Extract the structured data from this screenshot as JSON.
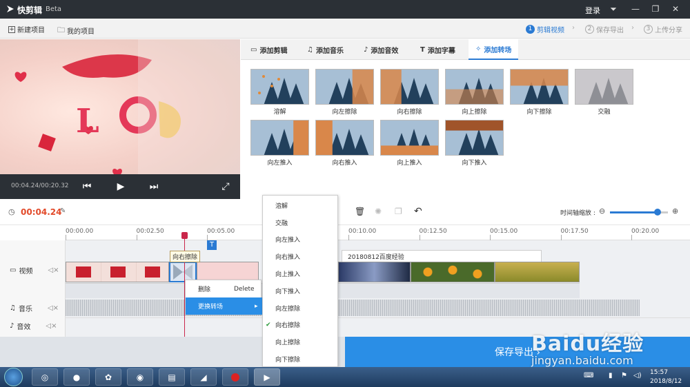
{
  "titlebar": {
    "app_name": "快剪辑",
    "beta": "Beta",
    "login": "登录"
  },
  "toolbar": {
    "new_project": "新建项目",
    "my_projects": "我的项目"
  },
  "steps": [
    {
      "num": "1",
      "label": "剪辑视频"
    },
    {
      "num": "2",
      "label": "保存导出"
    },
    {
      "num": "3",
      "label": "上传分享"
    }
  ],
  "preview": {
    "time": "00:04.24/00:20.32"
  },
  "tabs": [
    {
      "label": "添加剪辑"
    },
    {
      "label": "添加音乐"
    },
    {
      "label": "添加音效"
    },
    {
      "label": "添加字幕"
    },
    {
      "label": "添加转场"
    }
  ],
  "transitions": [
    {
      "label": "溶解"
    },
    {
      "label": "向左擦除"
    },
    {
      "label": "向右擦除"
    },
    {
      "label": "向上擦除"
    },
    {
      "label": "向下擦除"
    },
    {
      "label": "交融"
    },
    {
      "label": "向左推入"
    },
    {
      "label": "向右推入"
    },
    {
      "label": "向上推入"
    },
    {
      "label": "向下推入"
    }
  ],
  "timeline": {
    "current_time": "00:04.24",
    "zoom_label": "时间轴缩放 :",
    "zoom_level": 0.82,
    "ruler": [
      "00:00.00",
      "00:02.50",
      "00:05.00",
      "00:07.50",
      "00:10.00",
      "00:12.50",
      "00:15.00",
      "00:17.50",
      "00:20.00"
    ],
    "text_marker": "T",
    "subtitle_clip": "20180812百度经验"
  },
  "tracks": {
    "video": "视频",
    "music": "音乐",
    "sfx": "音效"
  },
  "tooltip": "向右擦除",
  "context_menu": {
    "delete": "删除",
    "delete_shortcut": "Delete",
    "replace": "更换转场"
  },
  "submenu": [
    {
      "label": "溶解",
      "checked": false
    },
    {
      "label": "交融",
      "checked": false
    },
    {
      "label": "向左推入",
      "checked": false
    },
    {
      "label": "向右推入",
      "checked": false
    },
    {
      "label": "向上推入",
      "checked": false
    },
    {
      "label": "向下推入",
      "checked": false
    },
    {
      "label": "向左擦除",
      "checked": false
    },
    {
      "label": "向右擦除",
      "checked": true
    },
    {
      "label": "向上擦除",
      "checked": false
    },
    {
      "label": "向下擦除",
      "checked": false
    }
  ],
  "export": {
    "label": "保存导出 ›"
  },
  "watermark": {
    "brand": "Baidu经验",
    "url": "jingyan.baidu.com"
  },
  "taskbar": {
    "time": "15:57",
    "date": "2018/8/12"
  },
  "colors": {
    "accent": "#2a7ad3",
    "time_red": "#e24a2a",
    "titlebar": "#2b3036",
    "export": "#2a8ee6"
  }
}
